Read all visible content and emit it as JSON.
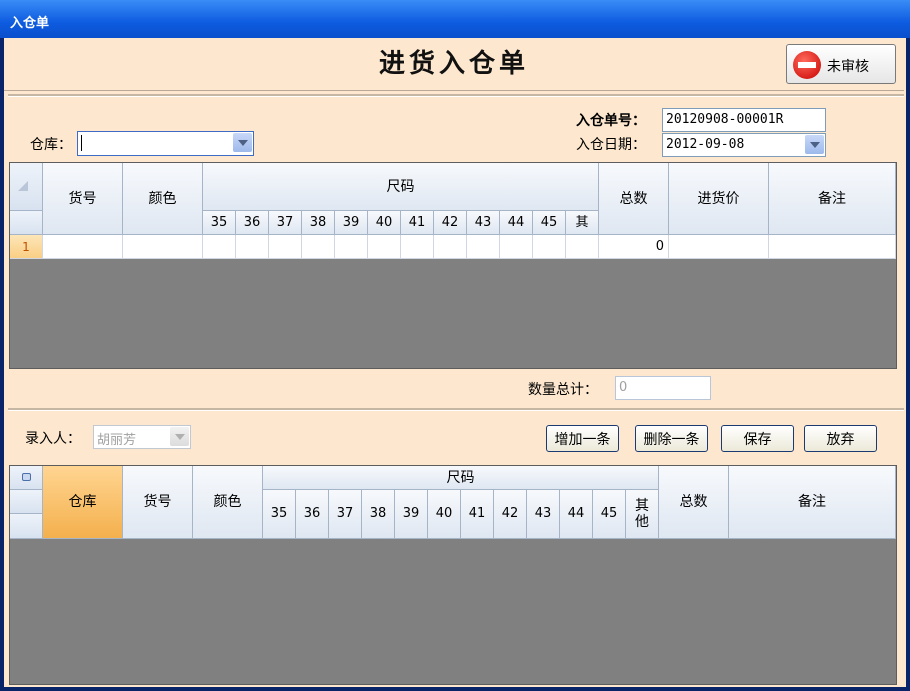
{
  "window": {
    "title": "入仓单"
  },
  "header": {
    "title": "进货入仓单",
    "audit_button": "未审核"
  },
  "form": {
    "warehouse_label": "仓库：",
    "warehouse_value": "",
    "order_no_label": "入仓单号：",
    "order_no_value": "20120908-00001R",
    "date_label": "入仓日期：",
    "date_value": "2012-09-08"
  },
  "top_grid": {
    "columns": {
      "item_no": "货号",
      "color": "颜色",
      "size": "尺码",
      "total": "总数",
      "price": "进货价",
      "remark": "备注"
    },
    "sizes": [
      "35",
      "36",
      "37",
      "38",
      "39",
      "40",
      "41",
      "42",
      "43",
      "44",
      "45",
      "其"
    ],
    "rows": [
      {
        "num": "1",
        "total": "0"
      }
    ]
  },
  "summary": {
    "label": "数量总计：",
    "value": "0"
  },
  "entry": {
    "label": "录入人：",
    "value": "胡丽芳"
  },
  "buttons": {
    "add": "增加一条",
    "delete": "删除一条",
    "save": "保存",
    "discard": "放弃"
  },
  "bottom_grid": {
    "columns": {
      "warehouse": "仓库",
      "item_no": "货号",
      "color": "颜色",
      "size": "尺码",
      "total": "总数",
      "remark": "备注"
    },
    "sizes": [
      "35",
      "36",
      "37",
      "38",
      "39",
      "40",
      "41",
      "42",
      "43",
      "44",
      "45",
      "其他"
    ]
  }
}
